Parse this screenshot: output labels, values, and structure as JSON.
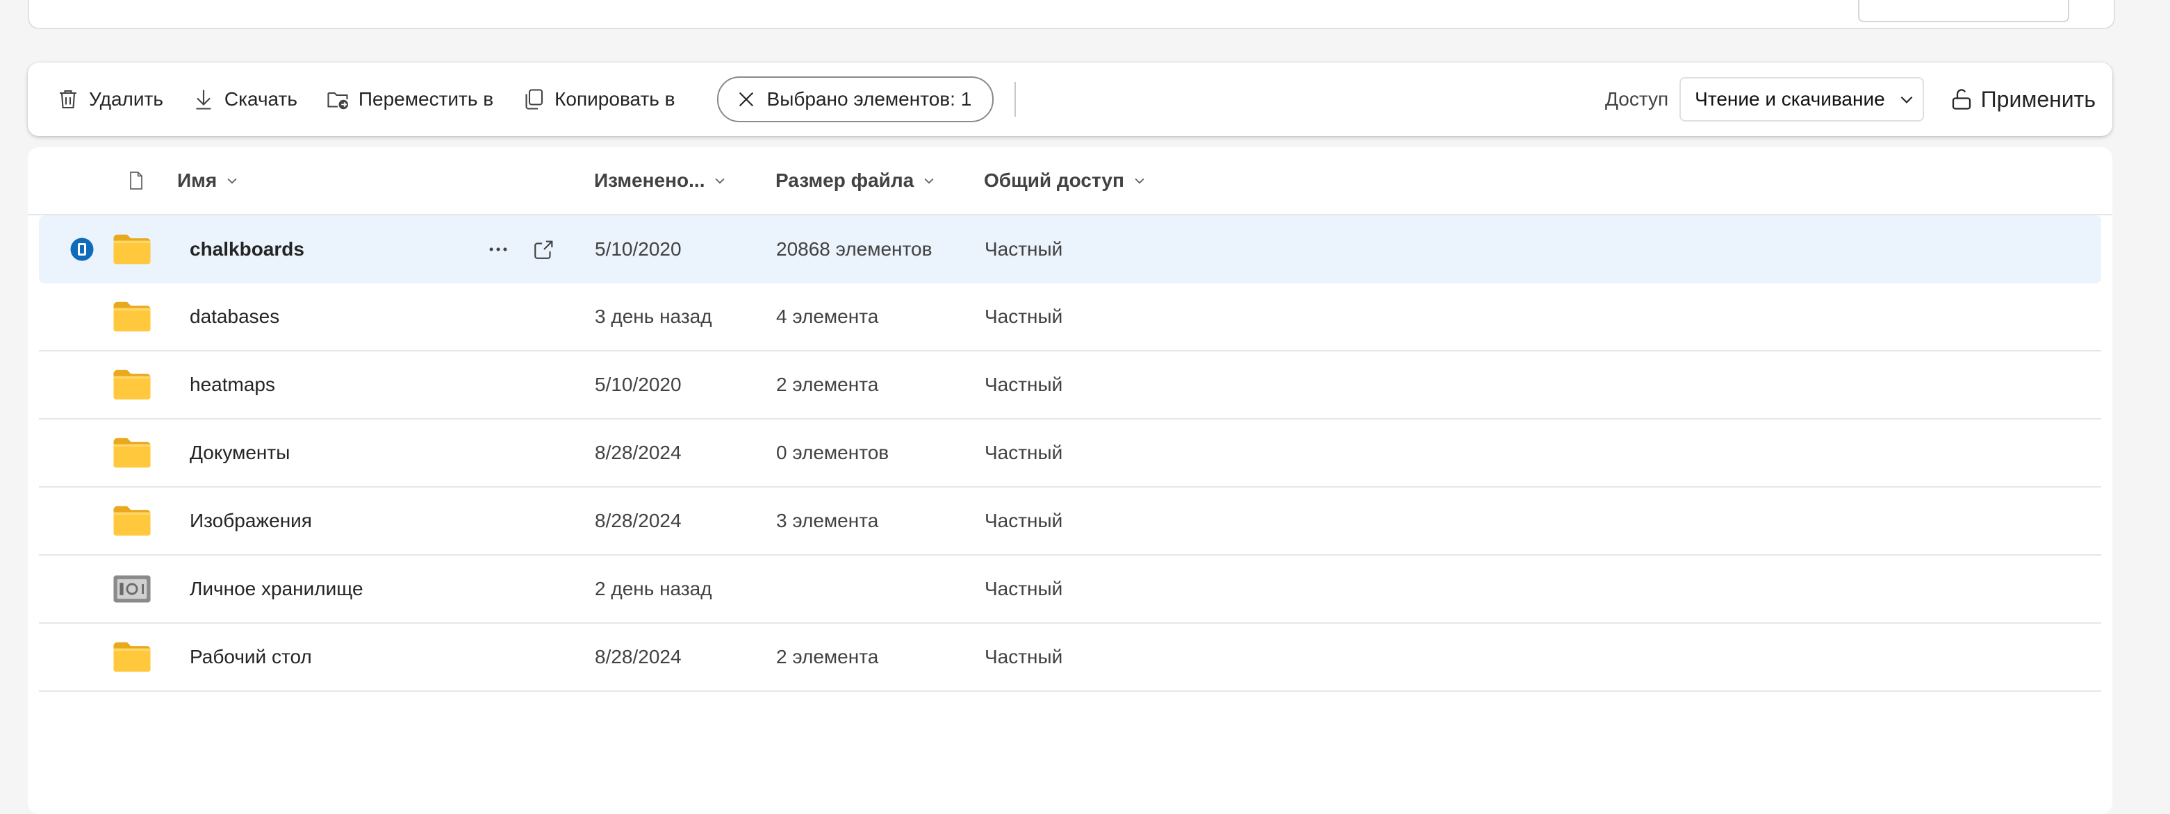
{
  "command_bar": {
    "delete_label": "Удалить",
    "download_label": "Скачать",
    "move_label": "Переместить в",
    "copy_label": "Копировать в",
    "selected_label": "Выбрано элементов: 1",
    "access_label": "Доступ",
    "access_value": "Чтение и скачивание",
    "apply_label": "Применить"
  },
  "columns": {
    "name": "Имя",
    "modified": "Изменено...",
    "size": "Размер файла",
    "sharing": "Общий доступ"
  },
  "rows": [
    {
      "name": "chalkboards",
      "modified": "5/10/2020",
      "size": "20868 элементов",
      "sharing": "Частный",
      "icon": "folder-icon",
      "selected": true
    },
    {
      "name": "databases",
      "modified": "3 день назад",
      "size": "4 элемента",
      "sharing": "Частный",
      "icon": "folder-icon"
    },
    {
      "name": "heatmaps",
      "modified": "5/10/2020",
      "size": "2 элемента",
      "sharing": "Частный",
      "icon": "folder-icon"
    },
    {
      "name": "Документы",
      "modified": "8/28/2024",
      "size": "0 элементов",
      "sharing": "Частный",
      "icon": "folder-icon"
    },
    {
      "name": "Изображения",
      "modified": "8/28/2024",
      "size": "3 элемента",
      "sharing": "Частный",
      "icon": "folder-icon"
    },
    {
      "name": "Личное хранилище",
      "modified": "2 день назад",
      "size": "",
      "sharing": "Частный",
      "icon": "vault-icon"
    },
    {
      "name": "Рабочий стол",
      "modified": "8/28/2024",
      "size": "2 элемента",
      "sharing": "Частный",
      "icon": "folder-icon"
    }
  ],
  "colors": {
    "selected_row": "#ebf3fc",
    "folder": "#ffc83d",
    "accent": "#0f6cbd"
  }
}
